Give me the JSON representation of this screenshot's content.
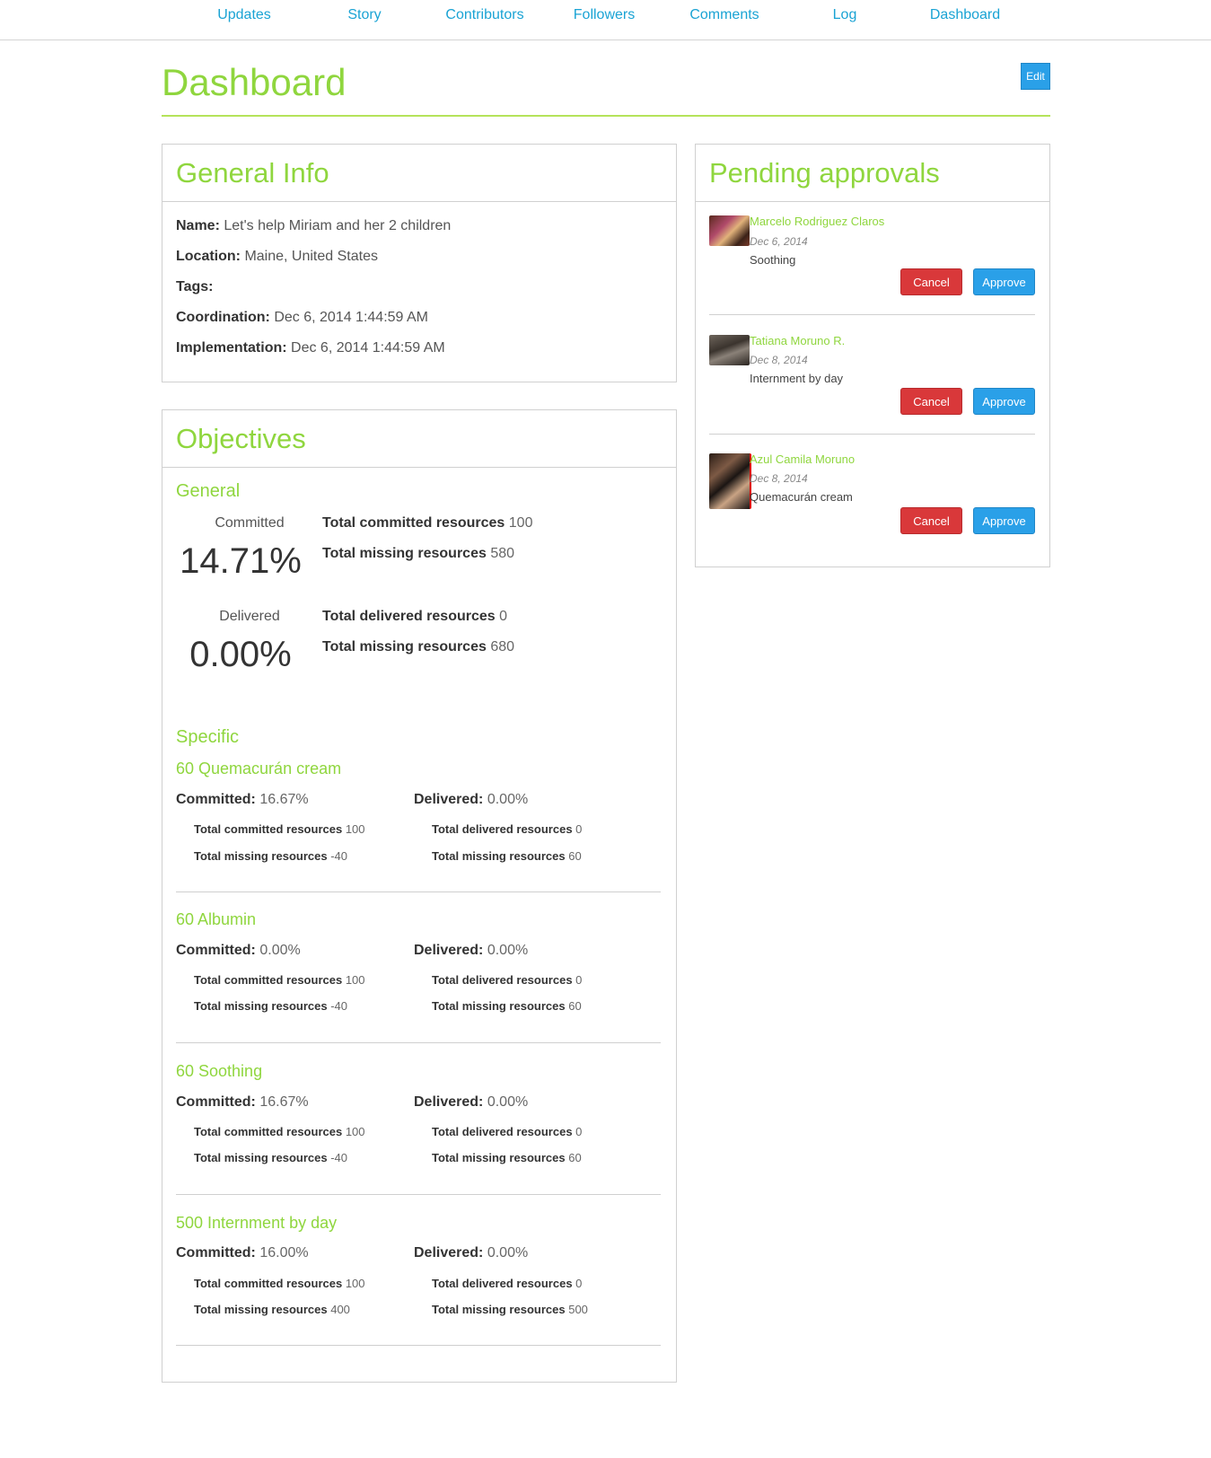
{
  "nav": {
    "items": [
      "Updates",
      "Story",
      "Contributors",
      "Followers",
      "Comments",
      "Log",
      "Dashboard"
    ]
  },
  "page": {
    "title": "Dashboard",
    "edit_label": "Edit"
  },
  "general_info": {
    "heading": "General Info",
    "name_label": "Name:",
    "name_value": "Let's help Miriam and her 2 children",
    "location_label": "Location:",
    "location_value": "Maine, United States",
    "tags_label": "Tags:",
    "coordination_label": "Coordination:",
    "coordination_value": "Dec 6, 2014 1:44:59 AM",
    "implementation_label": "Implementation:",
    "implementation_value": "Dec 6, 2014 1:44:59 AM"
  },
  "objectives": {
    "heading": "Objectives",
    "general": {
      "label": "General",
      "committed_caption": "Committed",
      "committed_percent": "14.71%",
      "total_committed_label": "Total committed resources",
      "total_committed_value": "100",
      "committed_missing_label": "Total missing resources",
      "committed_missing_value": "580",
      "delivered_caption": "Delivered",
      "delivered_percent": "0.00%",
      "total_delivered_label": "Total delivered resources",
      "total_delivered_value": "0",
      "delivered_missing_label": "Total missing resources",
      "delivered_missing_value": "680"
    },
    "specific_label": "Specific",
    "labels": {
      "committed": "Committed:",
      "delivered": "Delivered:",
      "total_committed": "Total committed resources",
      "total_delivered": "Total delivered resources",
      "total_missing": "Total missing resources"
    },
    "specific": [
      {
        "title": "60 Quemacurán cream",
        "committed": "16.67%",
        "delivered": "0.00%",
        "total_committed": "100",
        "committed_missing": "-40",
        "total_delivered": "0",
        "delivered_missing": "60"
      },
      {
        "title": "60 Albumin",
        "committed": "0.00%",
        "delivered": "0.00%",
        "total_committed": "100",
        "committed_missing": "-40",
        "total_delivered": "0",
        "delivered_missing": "60"
      },
      {
        "title": "60 Soothing",
        "committed": "16.67%",
        "delivered": "0.00%",
        "total_committed": "100",
        "committed_missing": "-40",
        "total_delivered": "0",
        "delivered_missing": "60"
      },
      {
        "title": "500 Internment by day",
        "committed": "16.00%",
        "delivered": "0.00%",
        "total_committed": "100",
        "committed_missing": "400",
        "total_delivered": "0",
        "delivered_missing": "500"
      }
    ]
  },
  "pending": {
    "heading": "Pending approvals",
    "cancel_label": "Cancel",
    "approve_label": "Approve",
    "items": [
      {
        "name": "Marcelo Rodriguez Claros",
        "date": "Dec 6, 2014",
        "item": "Soothing"
      },
      {
        "name": "Tatiana Moruno R.",
        "date": "Dec 8, 2014",
        "item": "Internment by day"
      },
      {
        "name": "Azul Camila Moruno",
        "date": "Dec 8, 2014",
        "item": "Quemacurán cream"
      }
    ]
  },
  "colors": {
    "accent_green": "#8fd63e",
    "link_blue": "#1aa3d4",
    "approve_blue": "#2aa0e8",
    "cancel_red": "#d9383a"
  }
}
